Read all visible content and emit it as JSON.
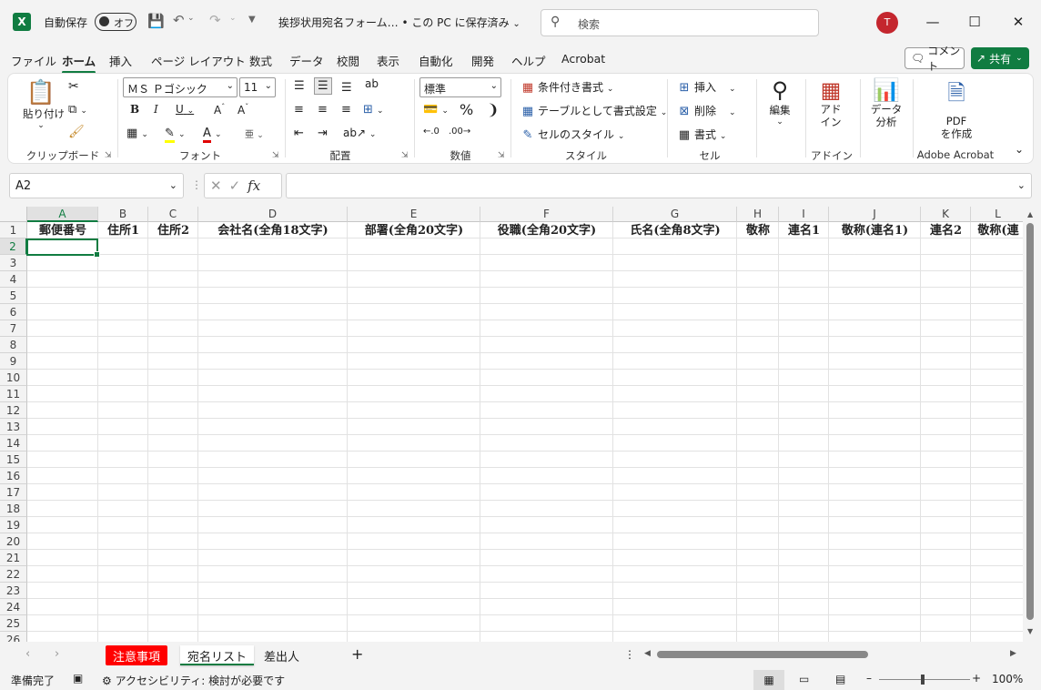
{
  "titlebar": {
    "autosave_label": "自動保存",
    "autosave_state": "オフ",
    "doc_title": "挨拶状用宛名フォーム… • この PC に保存済み",
    "search_placeholder": "検索",
    "avatar_initial": "T"
  },
  "menu": {
    "tabs": [
      "ファイル",
      "ホーム",
      "挿入",
      "ページ レイアウト",
      "数式",
      "データ",
      "校閲",
      "表示",
      "自動化",
      "開発",
      "ヘルプ",
      "Acrobat"
    ],
    "active_tab": "ホーム",
    "comment_label": "コメント",
    "share_label": "共有"
  },
  "ribbon": {
    "clipboard": {
      "paste_label": "貼り付け",
      "group_label": "クリップボード"
    },
    "font": {
      "font_name": "ＭＳ Ｐゴシック",
      "font_size": "11",
      "group_label": "フォント",
      "bold": "B",
      "italic": "I",
      "underline": "U"
    },
    "alignment": {
      "group_label": "配置"
    },
    "number": {
      "format": "標準",
      "group_label": "数値"
    },
    "styles": {
      "conditional": "条件付き書式",
      "table": "テーブルとして書式設定",
      "cell_style": "セルのスタイル",
      "group_label": "スタイル"
    },
    "cells": {
      "insert": "挿入",
      "delete": "削除",
      "format": "書式",
      "group_label": "セル"
    },
    "editing": {
      "label": "編集"
    },
    "addins": {
      "label_line1": "アド",
      "label_line2": "イン",
      "group_label": "アドイン"
    },
    "analysis": {
      "label_line1": "データ",
      "label_line2": "分析"
    },
    "acrobat": {
      "label_line1": "PDF",
      "label_line2": "を作成",
      "group_label": "Adobe Acrobat"
    }
  },
  "formula_bar": {
    "name_box": "A2",
    "formula": ""
  },
  "grid": {
    "columns": [
      "A",
      "B",
      "C",
      "D",
      "E",
      "F",
      "G",
      "H",
      "I",
      "J",
      "K",
      "L"
    ],
    "rows": [
      "1",
      "2",
      "3",
      "4",
      "5",
      "6",
      "7",
      "8",
      "9",
      "10",
      "11",
      "12",
      "13",
      "14",
      "15",
      "16",
      "17",
      "18",
      "19",
      "20",
      "21",
      "22",
      "23",
      "24",
      "25",
      "26"
    ],
    "header_row": [
      "郵便番号",
      "住所1",
      "住所2",
      "会社名(全角18文字)",
      "部署(全角20文字)",
      "役職(全角20文字)",
      "氏名(全角8文字)",
      "敬称",
      "連名1",
      "敬称(連名1)",
      "連名2",
      "敬称(連"
    ],
    "selected_cell": "A2"
  },
  "sheets": {
    "tabs": [
      "注意事項",
      "宛名リスト",
      "差出人"
    ],
    "active": "宛名リスト",
    "highlight_color": "#ff0000"
  },
  "status": {
    "ready": "準備完了",
    "accessibility": "アクセシビリティ: 検討が必要です",
    "zoom": "100%"
  }
}
